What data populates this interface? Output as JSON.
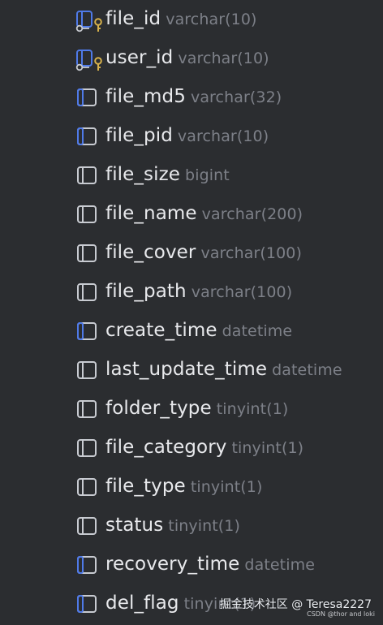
{
  "colors": {
    "background": "#2b2d30",
    "column_name": "#e8e9ec",
    "column_type": "#7d8088",
    "icon_gray": "#c8cbd1",
    "icon_blue": "#4f7ae8",
    "key_gold": "#d7b24c"
  },
  "columns": [
    {
      "name": "file_id",
      "type": "varchar(10)",
      "icon": "primary-key-icon"
    },
    {
      "name": "user_id",
      "type": "varchar(10)",
      "icon": "primary-key-icon"
    },
    {
      "name": "file_md5",
      "type": "varchar(32)",
      "icon": "indexed-column-icon"
    },
    {
      "name": "file_pid",
      "type": "varchar(10)",
      "icon": "indexed-column-icon"
    },
    {
      "name": "file_size",
      "type": "bigint",
      "icon": "column-icon"
    },
    {
      "name": "file_name",
      "type": "varchar(200)",
      "icon": "column-icon"
    },
    {
      "name": "file_cover",
      "type": "varchar(100)",
      "icon": "column-icon"
    },
    {
      "name": "file_path",
      "type": "varchar(100)",
      "icon": "column-icon"
    },
    {
      "name": "create_time",
      "type": "datetime",
      "icon": "indexed-column-icon"
    },
    {
      "name": "last_update_time",
      "type": "datetime",
      "icon": "column-icon"
    },
    {
      "name": "folder_type",
      "type": "tinyint(1)",
      "icon": "column-icon"
    },
    {
      "name": "file_category",
      "type": "tinyint(1)",
      "icon": "column-icon"
    },
    {
      "name": "file_type",
      "type": "tinyint(1)",
      "icon": "column-icon"
    },
    {
      "name": "status",
      "type": "tinyint(1)",
      "icon": "column-icon"
    },
    {
      "name": "recovery_time",
      "type": "datetime",
      "icon": "indexed-column-icon"
    },
    {
      "name": "del_flag",
      "type": "tinyint(1)",
      "icon": "indexed-column-icon"
    }
  ],
  "watermark": {
    "main": "掘金技术社区 @ Teresa2227",
    "sub": "CSDN @thor and loki"
  }
}
